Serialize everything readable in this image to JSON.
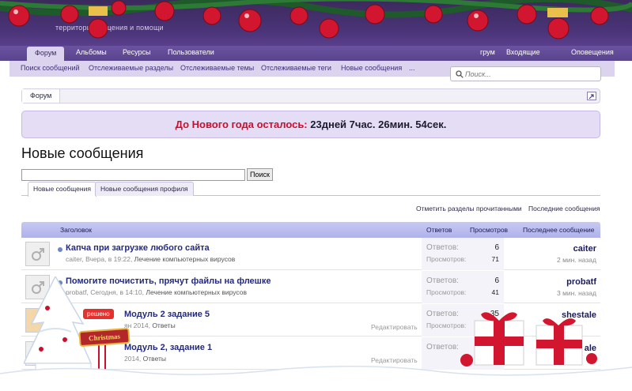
{
  "site": {
    "logo_text": "территория общения и помощи"
  },
  "nav": {
    "tabs": [
      {
        "label": "Форум",
        "active": true
      },
      {
        "label": "Альбомы"
      },
      {
        "label": "Ресурсы"
      },
      {
        "label": "Пользователи"
      }
    ],
    "right_items": [
      "грум",
      "Входящие",
      "Оповещения"
    ]
  },
  "subnav": {
    "links": [
      "Поиск сообщений",
      "Отслеживаемые разделы",
      "Отслеживаемые темы",
      "Отслеживаемые теги",
      "Новые сообщения",
      "..."
    ]
  },
  "search": {
    "placeholder": "Поиск..."
  },
  "breadcrumb": {
    "root": "Форум"
  },
  "countdown": {
    "label": "До Нового года осталось:",
    "value": "23дней 7час. 26мин. 54сек."
  },
  "page": {
    "title": "Новые сообщения",
    "search_button": "Поиск",
    "tabs": [
      {
        "label": "Новые сообщения",
        "active": true
      },
      {
        "label": "Новые сообщения профиля"
      }
    ],
    "actions": {
      "mark_read": "Отметить разделы прочитанными",
      "latest": "Последние сообщения"
    }
  },
  "table": {
    "headers": {
      "title": "Заголовок",
      "replies": "Ответов",
      "views": "Просмотров",
      "last": "Последнее сообщение"
    },
    "stat_labels": {
      "replies": "Ответов:",
      "views": "Просмотров:"
    },
    "edit_label": "Редактировать",
    "rows": [
      {
        "title": "Капча при загрузке любого сайта",
        "author": "caiter",
        "date": "Вчера, в 19:22",
        "forum": "Лечение компьютерных вирусов",
        "replies": "6",
        "views": "71",
        "last_user": "caiter",
        "last_time": "2 мин. назад",
        "prefix": ""
      },
      {
        "title": "Помогите почистить, прячут файлы на флешке",
        "author": "probatf",
        "date": "Сегодня, в 14:10",
        "forum": "Лечение компьютерных вирусов",
        "replies": "6",
        "views": "41",
        "last_user": "probatf",
        "last_time": "3 мин. назад",
        "prefix": ""
      },
      {
        "title": "Модуль 2 задание 5",
        "author": "",
        "date": "ян 2014",
        "forum": "Ответы",
        "replies": "35",
        "views": "",
        "last_user": "shestale",
        "last_time": "",
        "prefix": "решено"
      },
      {
        "title": "Модуль 2, задание 1",
        "author": "",
        "date": "2014",
        "forum": "Ответы",
        "replies": "",
        "views": "",
        "last_user": "ale",
        "last_time": "",
        "prefix": ""
      }
    ]
  },
  "decor": {
    "christmas_sign": "Christmas"
  },
  "colors": {
    "header_bg": "#4b3479",
    "countdown_label": "#c8102e",
    "title_link": "#232a7c",
    "table_header": "#b8bcef"
  }
}
